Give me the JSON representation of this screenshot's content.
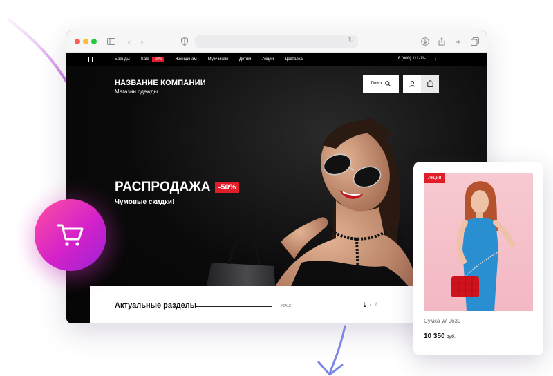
{
  "browser": {
    "address_value": ""
  },
  "site": {
    "nav": {
      "items": [
        "Бренды",
        "Sale",
        "Женщинам",
        "Мужчинам",
        "Детям",
        "Акции",
        "Доставка"
      ],
      "sale_badge": "-50%",
      "phone": "8 (000) 111-11-11",
      "more": "⋮"
    },
    "company": {
      "name": "НАЗВАНИЕ КОМПАНИИ",
      "subtitle": "Магазин одежды"
    },
    "search_label": "Поиск",
    "hero": {
      "title": "РАСПРОДАЖА",
      "discount": "-50%",
      "subtitle": "Чумовые скидки!"
    },
    "sections": {
      "title": "Актуальные разделы",
      "tag": "#SALE",
      "page_current": "1",
      "page_sep": "/",
      "page_total": "8"
    }
  },
  "product_card": {
    "badge": "Акция",
    "name": "Сумка W-9639",
    "price": "10 350",
    "currency": "руб."
  },
  "colors": {
    "accent_red": "#e11d2a",
    "bubble_pink": "#ff4fa0",
    "bubble_purple": "#9b21d6"
  }
}
